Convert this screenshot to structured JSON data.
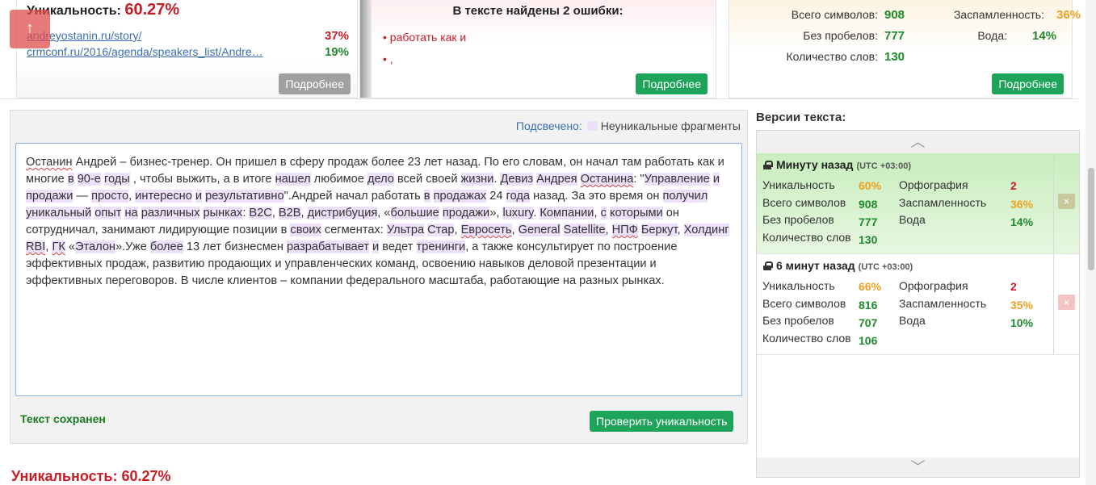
{
  "colors": {
    "red": "#c81d25",
    "green": "#1f8a2a",
    "orange": "#f0a020",
    "button_green": "#1ea45a",
    "highlight": "#ede0fb",
    "link": "#3a6fb0"
  },
  "uniqueness_card": {
    "title_label": "Уникальность:",
    "value": "60.27%",
    "sources": [
      {
        "url": "andreyostanin.ru/story/",
        "percent": "37%",
        "color": "#c81d25"
      },
      {
        "url": "crmconf.ru/2016/agenda/speakers_list/Andre…",
        "percent": "19%",
        "color": "#1f8a2a"
      }
    ],
    "more_button": "Подробнее",
    "scroll_up_icon": "arrow-up-icon",
    "scroll_up_glyph": "↑"
  },
  "errors_card": {
    "title": "В тексте найдены 2 ошибки:",
    "items": [
      "работать как и",
      ","
    ],
    "more_button": "Подробнее"
  },
  "stats_card": {
    "total_chars_label": "Всего символов:",
    "total_chars": "908",
    "no_spaces_label": "Без пробелов:",
    "no_spaces": "777",
    "words_label": "Количество слов:",
    "words": "130",
    "spam_label": "Заспамленность:",
    "spam": "36%",
    "water_label": "Вода:",
    "water": "14%",
    "more_button": "Подробнее"
  },
  "editor": {
    "highlight_label": "Подсвечено:",
    "highlight_desc": "Неуникальные фрагменты",
    "saved_status": "Текст сохранен",
    "check_button": "Проверить уникальность"
  },
  "bottom_uniqueness": "Уникальность: 60.27%",
  "versions": {
    "title": "Версии текста:",
    "scroll_up_icon": "chevron-up-icon",
    "scroll_down_icon": "chevron-down-icon",
    "chevron_up": "︿",
    "chevron_down": "﹀",
    "delete_glyph": "×",
    "items": [
      {
        "time": "Минуту назад",
        "tz": "(UTC +03:00)",
        "uniq_label": "Уникальность",
        "uniq": "60%",
        "chars_label": "Всего символов",
        "chars": "908",
        "nospace_label": "Без пробелов",
        "nospace": "777",
        "words_label": "Количество слов",
        "words": "130",
        "spell_label": "Орфография",
        "spell": "2",
        "spam_label": "Заспамленность",
        "spam": "36%",
        "water_label": "Вода",
        "water": "14%",
        "active": true
      },
      {
        "time": "6 минут назад",
        "tz": "(UTC +03:00)",
        "uniq_label": "Уникальность",
        "uniq": "66%",
        "chars_label": "Всего символов",
        "chars": "816",
        "nospace_label": "Без пробелов",
        "nospace": "707",
        "words_label": "Количество слов",
        "words": "106",
        "spell_label": "Орфография",
        "spell": "2",
        "spam_label": "Заспамленность",
        "spam": "35%",
        "water_label": "Вода",
        "water": "10%",
        "active": false
      }
    ]
  },
  "text_tokens": [
    {
      "t": "Останин",
      "s": 1
    },
    {
      "t": " Андрей – бизнес-тренер. Он пришел в сферу продаж более 23 лет назад. По его словам, он начал там работать как и многие "
    },
    {
      "t": "в",
      "h": 1
    },
    {
      "t": " "
    },
    {
      "t": "90-е",
      "h": 1
    },
    {
      "t": " "
    },
    {
      "t": "годы",
      "h": 1
    },
    {
      "t": " , чтобы выжить, а в итоге "
    },
    {
      "t": "нашел",
      "h": 1
    },
    {
      "t": " любимое "
    },
    {
      "t": "дело",
      "h": 1
    },
    {
      "t": " всей своей "
    },
    {
      "t": "жизни",
      "h": 1
    },
    {
      "t": ". "
    },
    {
      "t": "Девиз",
      "h": 1
    },
    {
      "t": " "
    },
    {
      "t": "Андрея",
      "h": 1
    },
    {
      "t": " "
    },
    {
      "t": "Останина",
      "h": 1,
      "s": 1
    },
    {
      "t": ": \""
    },
    {
      "t": "Управление",
      "h": 1
    },
    {
      "t": " "
    },
    {
      "t": "и",
      "h": 1
    },
    {
      "t": " "
    },
    {
      "t": "продажи",
      "h": 1
    },
    {
      "t": " — "
    },
    {
      "t": "просто",
      "h": 1
    },
    {
      "t": ", "
    },
    {
      "t": "интересно",
      "h": 1
    },
    {
      "t": " "
    },
    {
      "t": "и",
      "h": 1
    },
    {
      "t": " "
    },
    {
      "t": "результативно",
      "h": 1
    },
    {
      "t": "\".Андрей начал работать "
    },
    {
      "t": "в",
      "h": 1
    },
    {
      "t": " "
    },
    {
      "t": "продажах",
      "h": 1
    },
    {
      "t": " 24 "
    },
    {
      "t": "года",
      "h": 1
    },
    {
      "t": " назад. За это время он "
    },
    {
      "t": "получил",
      "h": 1
    },
    {
      "t": " "
    },
    {
      "t": "уникальный",
      "h": 1
    },
    {
      "t": " "
    },
    {
      "t": "опыт",
      "h": 1
    },
    {
      "t": " "
    },
    {
      "t": "на",
      "h": 1
    },
    {
      "t": " "
    },
    {
      "t": "различных",
      "h": 1
    },
    {
      "t": " "
    },
    {
      "t": "рынках",
      "h": 1
    },
    {
      "t": ": "
    },
    {
      "t": "B2C",
      "h": 1
    },
    {
      "t": ", "
    },
    {
      "t": "B2B",
      "h": 1
    },
    {
      "t": ", "
    },
    {
      "t": "дистрибуция",
      "h": 1
    },
    {
      "t": ", «"
    },
    {
      "t": "большие",
      "h": 1
    },
    {
      "t": " "
    },
    {
      "t": "продажи",
      "h": 1
    },
    {
      "t": "», "
    },
    {
      "t": "luxury",
      "h": 1
    },
    {
      "t": ". "
    },
    {
      "t": "Компании",
      "h": 1
    },
    {
      "t": ", "
    },
    {
      "t": "с",
      "h": 1
    },
    {
      "t": " "
    },
    {
      "t": "которыми",
      "h": 1
    },
    {
      "t": " он сотрудничал, занимают лидирующие позиции в "
    },
    {
      "t": "своих",
      "h": 1
    },
    {
      "t": " сегментах: "
    },
    {
      "t": "Ультра",
      "h": 1
    },
    {
      "t": " "
    },
    {
      "t": "Стар",
      "h": 1
    },
    {
      "t": ", "
    },
    {
      "t": "Евросеть",
      "h": 1,
      "s": 1
    },
    {
      "t": ", "
    },
    {
      "t": "General",
      "h": 1
    },
    {
      "t": " "
    },
    {
      "t": "Satellite",
      "h": 1
    },
    {
      "t": ", "
    },
    {
      "t": "НПФ",
      "h": 1,
      "s": 1
    },
    {
      "t": " "
    },
    {
      "t": "Беркут",
      "h": 1
    },
    {
      "t": ", "
    },
    {
      "t": "Холдинг",
      "h": 1
    },
    {
      "t": " "
    },
    {
      "t": "RBI",
      "h": 1,
      "s": 1
    },
    {
      "t": ", "
    },
    {
      "t": "ГК",
      "h": 1,
      "s": 1
    },
    {
      "t": " «"
    },
    {
      "t": "Эталон",
      "h": 1
    },
    {
      "t": "».Уже "
    },
    {
      "t": "более",
      "h": 1
    },
    {
      "t": " 13 лет бизнесмен "
    },
    {
      "t": "разрабатывает",
      "h": 1
    },
    {
      "t": " "
    },
    {
      "t": "и",
      "h": 1
    },
    {
      "t": " ведет "
    },
    {
      "t": "тренинги",
      "h": 1
    },
    {
      "t": ", а также консультирует по построение эффективных продаж, развитию продающих и управленческих команд, освоению навыков деловой презентации и эффективных переговоров. В числе клиентов – компании федерального масштаба, работающие на разных рынках."
    }
  ]
}
